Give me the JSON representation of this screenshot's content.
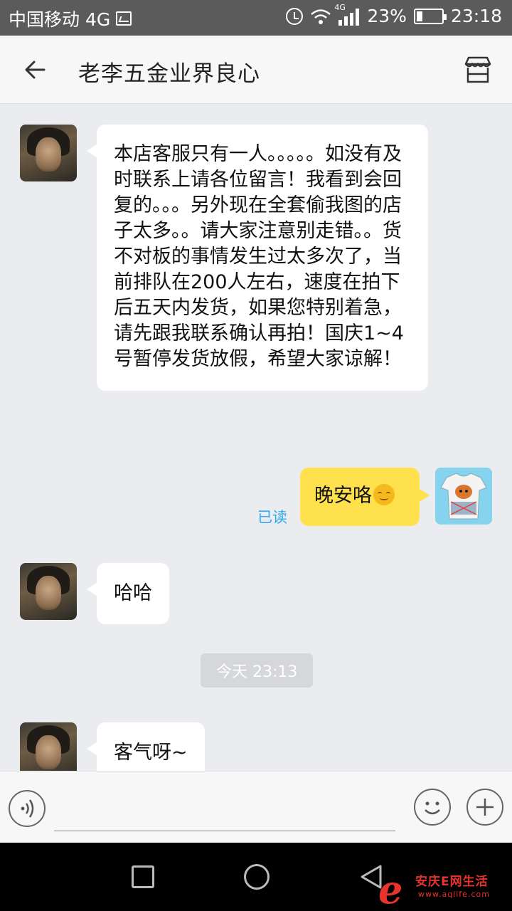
{
  "status_bar": {
    "carrier": "中国移动 4G",
    "network_badge": "4G",
    "battery": "23%",
    "battery_level_percent": 23,
    "time": "23:18"
  },
  "header": {
    "title": "老李五金业界良心",
    "back_icon": "arrow-left-icon",
    "shop_icon": "store-icon"
  },
  "messages": [
    {
      "side": "incoming",
      "text": "本店客服只有一人。。。。。如没有及时联系上请各位留言！我看到会回复的。。。另外现在全套偷我图的店子太多。。请大家注意别走错。。货不对板的事情发生过太多次了，当前排队在200人左右，速度在拍下后五天内发货，如果您特别着急，请先跟我联系确认再拍！国庆1~4号暂停发货放假，希望大家谅解！"
    },
    {
      "side": "outgoing",
      "text": "晚安咯",
      "emoji": "smile-emoji",
      "read_status": "已读"
    },
    {
      "side": "incoming",
      "text": "哈哈"
    },
    {
      "side": "incoming",
      "text": "客气呀~"
    }
  ],
  "time_divider": "今天 23:13",
  "input_bar": {
    "placeholder": "",
    "voice_icon": "voice-icon",
    "emoji_icon": "emoji-icon",
    "plus_icon": "plus-icon"
  },
  "nav_bar": {
    "recents_icon": "square-icon",
    "home_icon": "circle-icon",
    "back_icon": "triangle-back-icon"
  },
  "watermark": {
    "logo_letter": "e",
    "name": "安庆E网生活",
    "url": "www.aqlife.com"
  }
}
